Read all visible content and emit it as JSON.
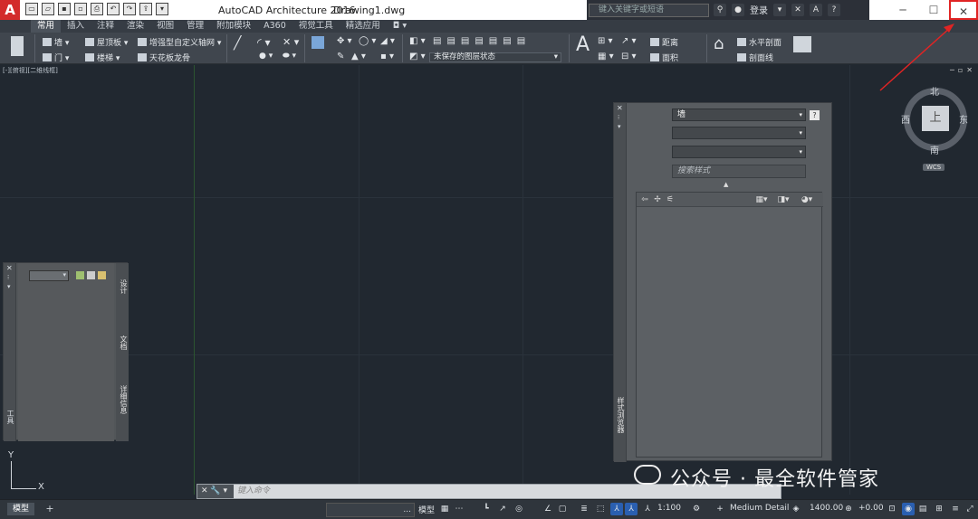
{
  "titlebar": {
    "app_title": "AutoCAD Architecture 2016",
    "file_name": "Drawing1.dwg",
    "search_placeholder": "键入关键字或短语",
    "login": "登录",
    "help": "?",
    "logo_letter": "A"
  },
  "ribbon_tabs": [
    "常用",
    "插入",
    "注释",
    "渲染",
    "视图",
    "管理",
    "附加模块",
    "A360",
    "视觉工具",
    "精选应用"
  ],
  "active_tab": "常用",
  "ribbon": {
    "wall": "墙",
    "door": "门",
    "slab": "屋顶板",
    "stair": "楼梯",
    "enhanced_grid": "增强型自定义轴网",
    "ceiling_grid": "天花板龙骨",
    "layer_state": "未保存的图层状态",
    "text_big": "A",
    "distance": "距离",
    "area": "面积",
    "horizontal_section": "水平剖面",
    "section_line": "剖面线",
    "layer_dropdown_value": "未保存的图层状态"
  },
  "viewport": {
    "label": "[-][俯视][二维线框]",
    "viewcube": {
      "north": "北",
      "south": "南",
      "east": "东",
      "west": "西",
      "face": "上",
      "wcs": "WCS"
    },
    "ucs": {
      "x": "X",
      "y": "Y"
    }
  },
  "left_palette": {
    "tabs": [
      "设计",
      "文档",
      "详细信息"
    ],
    "title": "工具"
  },
  "right_palette": {
    "object_type": "墙",
    "search_placeholder": "搜索样式",
    "vertical_title": "样式浏览器"
  },
  "command_line": {
    "placeholder": "键入命令"
  },
  "statusbar": {
    "model_tab": "模型",
    "model_label": "模型",
    "scale": "1:100",
    "detail": "Medium Detail",
    "elevation": "1400.00",
    "offset": "+0.00"
  },
  "watermark": "公众号 · 最全软件管家",
  "window_controls": {
    "minimize": "─",
    "maximize": "☐",
    "close": "✕"
  }
}
